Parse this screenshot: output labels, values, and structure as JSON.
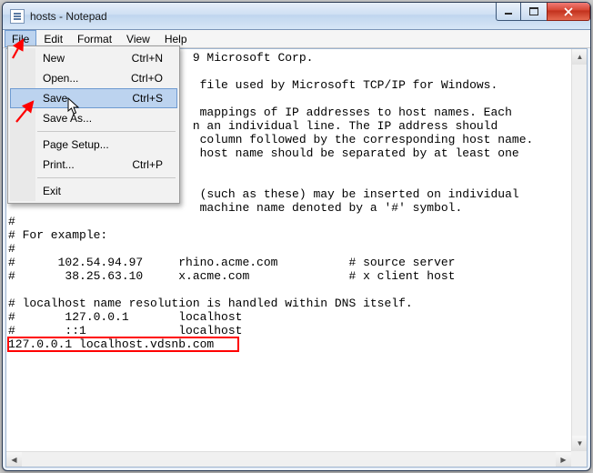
{
  "window": {
    "title": "hosts - Notepad"
  },
  "menubar": {
    "items": [
      {
        "label": "File",
        "active": true
      },
      {
        "label": "Edit",
        "active": false
      },
      {
        "label": "Format",
        "active": false
      },
      {
        "label": "View",
        "active": false
      },
      {
        "label": "Help",
        "active": false
      }
    ]
  },
  "dropdown": {
    "items": [
      {
        "label": "New",
        "shortcut": "Ctrl+N",
        "hover": false
      },
      {
        "label": "Open...",
        "shortcut": "Ctrl+O",
        "hover": false
      },
      {
        "label": "Save",
        "shortcut": "Ctrl+S",
        "hover": true
      },
      {
        "label": "Save As...",
        "shortcut": "",
        "hover": false
      },
      {
        "sep": true
      },
      {
        "label": "Page Setup...",
        "shortcut": "",
        "hover": false
      },
      {
        "label": "Print...",
        "shortcut": "Ctrl+P",
        "hover": false
      },
      {
        "sep": true
      },
      {
        "label": "Exit",
        "shortcut": "",
        "hover": false
      }
    ]
  },
  "text_lines": [
    "                          9 Microsoft Corp.",
    "#",
    "                           file used by Microsoft TCP/IP for Windows.",
    "#",
    "                           mappings of IP addresses to host names. Each",
    "                          n an individual line. The IP address should",
    "                           column followed by the corresponding host name.",
    "                           host name should be separated by at least one",
    "",
    "#",
    "                           (such as these) may be inserted on individual",
    "                           machine name denoted by a '#' symbol.",
    "#",
    "# For example:",
    "#",
    "#      102.54.94.97     rhino.acme.com          # source server",
    "#       38.25.63.10     x.acme.com              # x client host",
    "",
    "# localhost name resolution is handled within DNS itself.",
    "#       127.0.0.1       localhost",
    "#       ::1             localhost",
    "127.0.0.1 localhost.vdsnb.com"
  ],
  "annotations": {
    "arrow_color": "#ff0000",
    "highlight_color": "#ff0000"
  }
}
